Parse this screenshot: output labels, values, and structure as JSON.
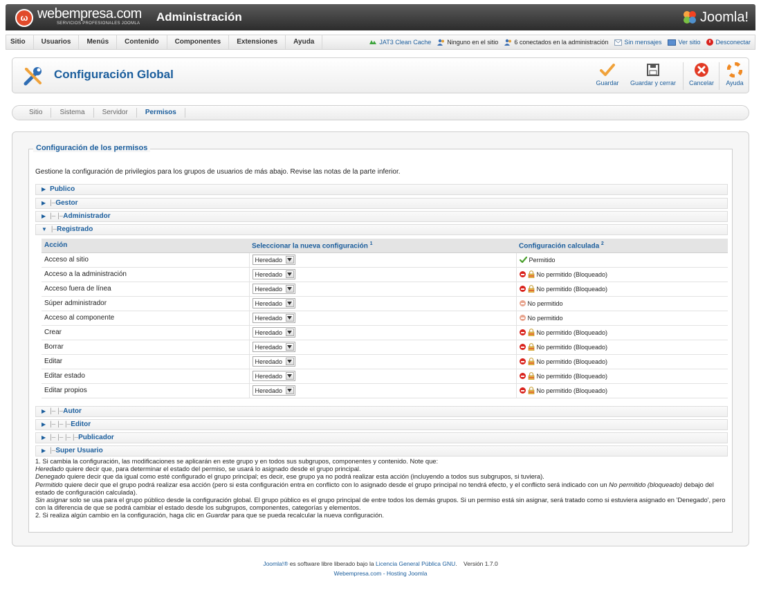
{
  "header": {
    "brand_name": "webempresa.com",
    "brand_sub": "SERVICIOS PROFESIONALES JOOMLA",
    "admin_title": "Administración",
    "joomla_logo_text": "Joomla!"
  },
  "menu": {
    "items": [
      "Sitio",
      "Usuarios",
      "Menús",
      "Contenido",
      "Componentes",
      "Extensiones",
      "Ayuda"
    ],
    "status": {
      "cache": "JAT3 Clean Cache",
      "none_on_site": "Ninguno en el sitio",
      "connected_admin": "6 conectados en la administración",
      "messages": "Sin mensajes",
      "view_site": "Ver sitio",
      "logout": "Desconectar"
    }
  },
  "toolbar": {
    "title": "Configuración Global",
    "save": "Guardar",
    "save_close": "Guardar y cerrar",
    "cancel": "Cancelar",
    "help": "Ayuda"
  },
  "tabs": [
    "Sitio",
    "Sistema",
    "Servidor",
    "Permisos"
  ],
  "permissions": {
    "legend": "Configuración de los permisos",
    "intro": "Gestione la configuración de privilegios para los grupos de usuarios de más abajo. Revise las notas de la parte inferior.",
    "groups_top": [
      {
        "prefix": "",
        "name": "Publico"
      },
      {
        "prefix": "|–",
        "name": "Gestor"
      },
      {
        "prefix": "|– |–",
        "name": "Administrador"
      },
      {
        "prefix": "|–",
        "name": "Registrado"
      }
    ],
    "groups_bottom": [
      {
        "prefix": "|– |–",
        "name": "Autor"
      },
      {
        "prefix": "|– |– |–",
        "name": "Editor"
      },
      {
        "prefix": "|– |– |– |–",
        "name": "Publicador"
      },
      {
        "prefix": "|–",
        "name": "Super Usuario"
      }
    ],
    "table": {
      "col_action": "Acción",
      "col_new": "Seleccionar la nueva configuración",
      "col_new_sup": "1",
      "col_calc": "Configuración calculada",
      "col_calc_sup": "2",
      "select_value": "Heredado",
      "rows": [
        {
          "action": "Acceso al sitio",
          "calc": "Permitido",
          "state": "allowed"
        },
        {
          "action": "Acceso a la administración",
          "calc": "No permitido (Bloqueado)",
          "state": "locked"
        },
        {
          "action": "Acceso fuera de línea",
          "calc": "No permitido (Bloqueado)",
          "state": "locked"
        },
        {
          "action": "Súper administrador",
          "calc": "No permitido",
          "state": "denied"
        },
        {
          "action": "Acceso al componente",
          "calc": "No permitido",
          "state": "denied"
        },
        {
          "action": "Crear",
          "calc": "No permitido (Bloqueado)",
          "state": "locked"
        },
        {
          "action": "Borrar",
          "calc": "No permitido (Bloqueado)",
          "state": "locked"
        },
        {
          "action": "Editar",
          "calc": "No permitido (Bloqueado)",
          "state": "locked"
        },
        {
          "action": "Editar estado",
          "calc": "No permitido (Bloqueado)",
          "state": "locked"
        },
        {
          "action": "Editar propios",
          "calc": "No permitido (Bloqueado)",
          "state": "locked"
        }
      ]
    },
    "notes": {
      "n1": "1. Si cambia la configuración, las modificaciones se aplicarán en este grupo y en todos sus subgrupos, componentes y contenido. Note que:",
      "heredado_em": "Heredado",
      "heredado_txt": " quiere decir que, para determinar el estado del permiso, se usará lo asignado desde el grupo principal.",
      "denegado_em": "Denegado",
      "denegado_txt": " quiere decir que da igual como esté configurado el grupo principal; es decir, ese grupo ya no podrá realizar esta acción (incluyendo a todos sus subgrupos, si tuviera).",
      "permitido_em": "Permitido",
      "permitido_txt": " quiere decir que el grupo podrá realizar esa acción (pero si esta configuración entra en conflicto con lo asignado desde el grupo principal no tendrá efecto, y el conflicto será indicado con un ",
      "permitido_em2": "No permitido (bloqueado)",
      "permitido_txt2": " debajo del estado de configuración calculada).",
      "sinasignar_em": "Sin asignar",
      "sinasignar_txt": " solo se usa para el grupo público desde la configuración global. El grupo público es el grupo principal de entre todos los demás grupos. Si un permiso está sin asignar, será tratado como si estuviera asignado en 'Denegado', pero con la diferencia de que se podrá cambiar el estado desde los subgrupos, componentes, categorías y elementos.",
      "n2_a": "2. Si realiza algún cambio en la configuración, haga clic en ",
      "n2_em": "Guardar",
      "n2_b": " para que se pueda recalcular la nueva configuración."
    }
  },
  "footer": {
    "joomla": "Joomla!®",
    "text1": " es software libre liberado bajo la ",
    "license": "Licencia General Pública GNU",
    "text2": ".    Versión 1.7.0",
    "hosting": "Webempresa.com - Hosting Joomla"
  },
  "colors": {
    "accent": "#1a5d9c",
    "topbar": "#3a3a3a",
    "deny": "#d9221c",
    "allow": "#4aa02c"
  }
}
